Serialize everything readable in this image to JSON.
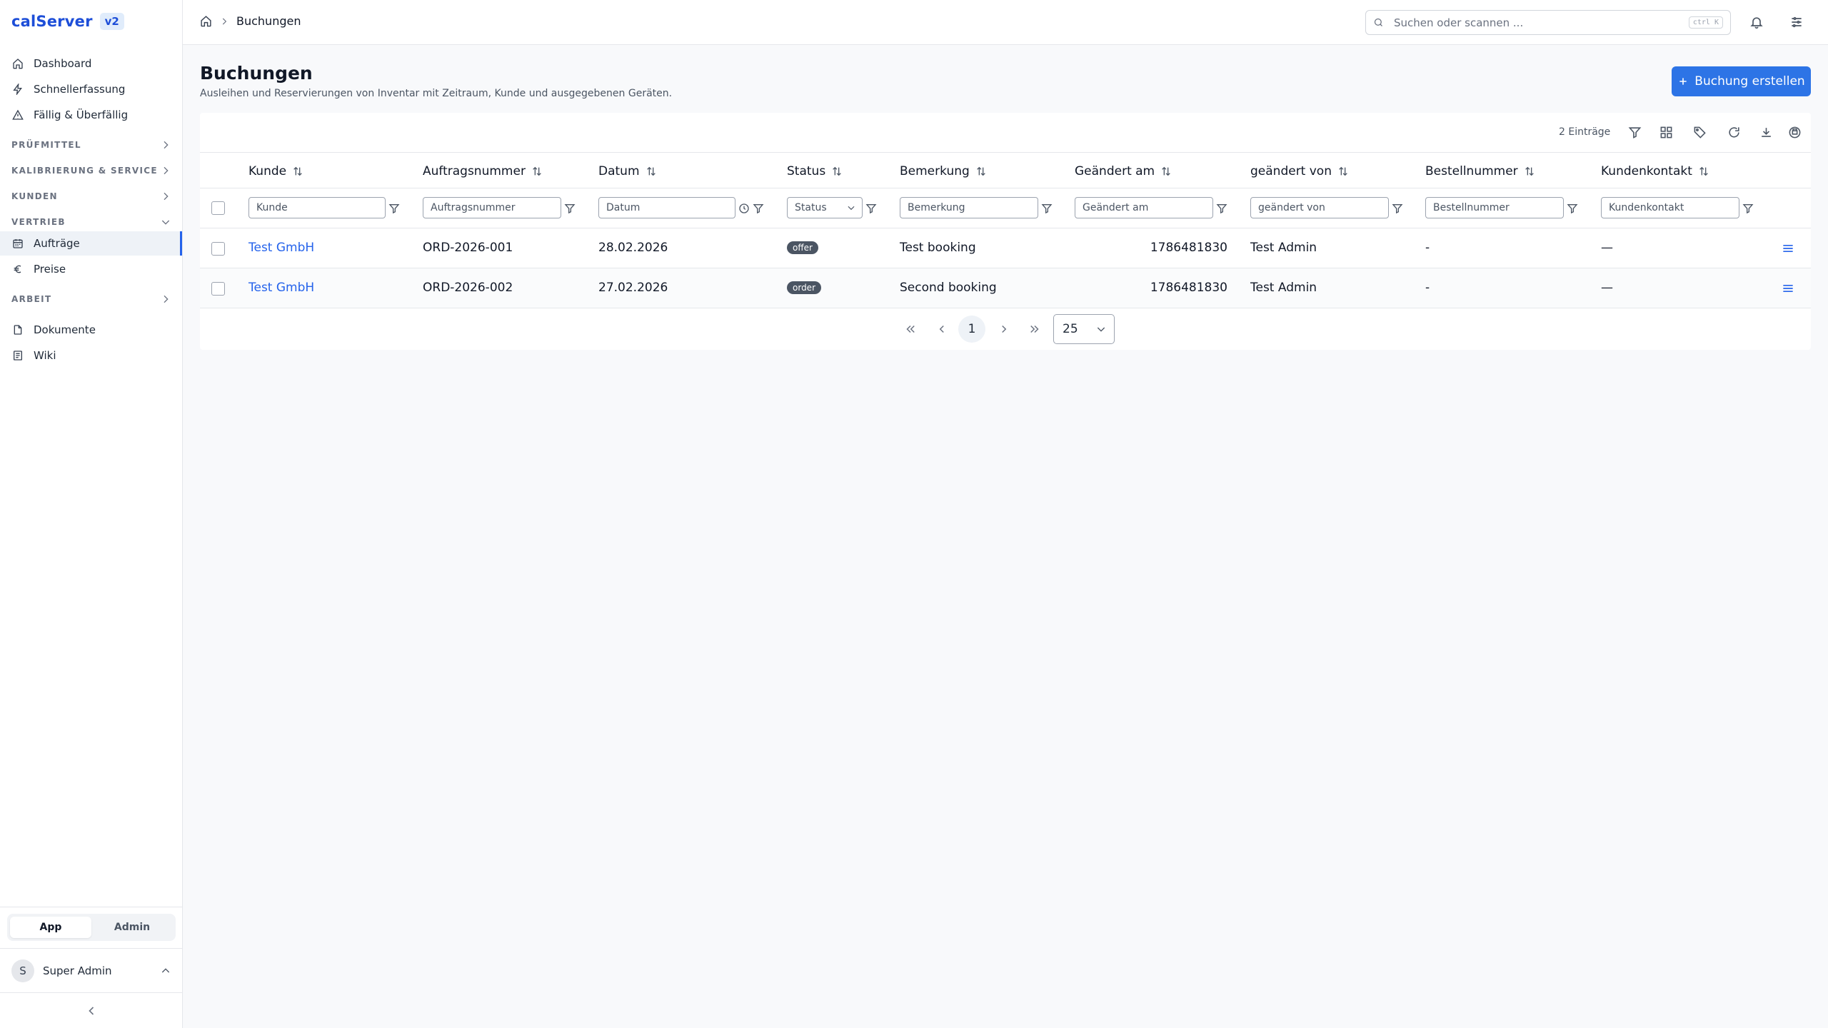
{
  "app": {
    "name": "calServer",
    "version": "v2"
  },
  "sidebar": {
    "top_items": [
      {
        "label": "Dashboard",
        "icon": "home-icon"
      },
      {
        "label": "Schnellerfassung",
        "icon": "lightning-icon"
      },
      {
        "label": "Fällig & Überfällig",
        "icon": "warning-icon"
      }
    ],
    "sections": {
      "pruefmittel": "PRÜFMITTEL",
      "kalibrierung": "KALIBRIERUNG & SERVICE",
      "kunden": "KUNDEN",
      "vertrieb": "VERTRIEB",
      "arbeit": "ARBEIT"
    },
    "vertrieb_items": [
      {
        "label": "Aufträge",
        "icon": "calendar-icon",
        "active": true
      },
      {
        "label": "Preise",
        "icon": "euro-icon",
        "active": false
      }
    ],
    "bottom_items": [
      {
        "label": "Dokumente",
        "icon": "document-icon"
      },
      {
        "label": "Wiki",
        "icon": "book-icon"
      }
    ],
    "mode": {
      "app": "App",
      "admin": "Admin",
      "selected": "App"
    },
    "user": {
      "initial": "S",
      "name": "Super Admin"
    }
  },
  "topbar": {
    "breadcrumb": "Buchungen",
    "search_placeholder": "Suchen oder scannen ...",
    "search_shortcut": "ctrl K"
  },
  "page": {
    "title": "Buchungen",
    "subtitle": "Ausleihen und Reservierungen von Inventar mit Zeitraum, Kunde und ausgegebenen Geräten.",
    "create_button": "Buchung erstellen"
  },
  "table": {
    "count": "2 Einträge",
    "columns": [
      "Kunde",
      "Auftragsnummer",
      "Datum",
      "Status",
      "Bemerkung",
      "Geändert am",
      "geändert von",
      "Bestellnummer",
      "Kundenkontakt"
    ],
    "filters": {
      "kunde": "Kunde",
      "auftragsnummer": "Auftragsnummer",
      "datum": "Datum",
      "status": "Status",
      "bemerkung": "Bemerkung",
      "geaendert_am": "Geändert am",
      "geaendert_von": "geändert von",
      "bestellnummer": "Bestellnummer",
      "kundenkontakt": "Kundenkontakt"
    },
    "rows": [
      {
        "kunde": "Test GmbH",
        "auftragsnummer": "ORD-2026-001",
        "datum": "28.02.2026",
        "status": "offer",
        "bemerkung": "Test booking",
        "geaendert_am": "1786481830",
        "geaendert_von": "Test Admin",
        "bestellnummer": "-",
        "kundenkontakt": "—"
      },
      {
        "kunde": "Test GmbH",
        "auftragsnummer": "ORD-2026-002",
        "datum": "27.02.2026",
        "status": "order",
        "bemerkung": "Second booking",
        "geaendert_am": "1786481830",
        "geaendert_von": "Test Admin",
        "bestellnummer": "-",
        "kundenkontakt": "—"
      }
    ]
  },
  "pagination": {
    "current_page": "1",
    "page_size": "25"
  },
  "colors": {
    "accent": "#2d74e6",
    "link": "#2563eb",
    "badge": "#4b5563"
  }
}
